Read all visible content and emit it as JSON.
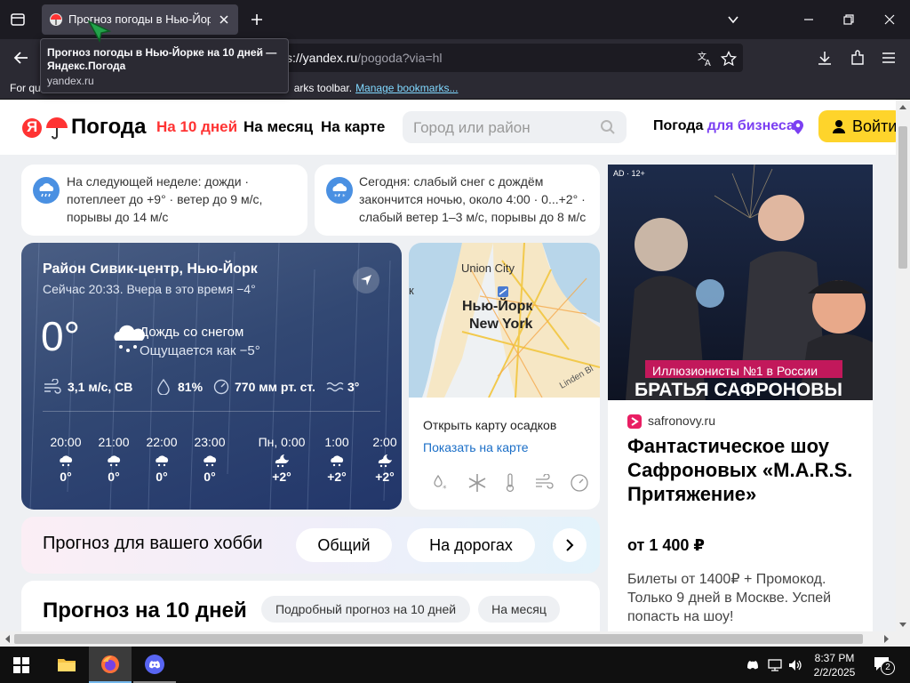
{
  "browser": {
    "tab_title": "Прогноз погоды в Нью-Йорке на 10 дней — Яндекс.Погода",
    "tooltip_title": "Прогноз погоды в Нью-Йорке на 10 дней — Яндекс.Погода",
    "tooltip_domain": "yandex.ru",
    "url_host": "s://yandex.ru",
    "url_path": "/pogoda?via=hl",
    "bookmarks_text_left": "For qu",
    "bookmarks_text_right": "arks toolbar.",
    "bookmarks_link": "Manage bookmarks..."
  },
  "header": {
    "logo_letter": "Я",
    "logo_text": "Погода",
    "nav": [
      "На 10 дней",
      "На месяц",
      "На карте"
    ],
    "search_placeholder": "Город или район",
    "business_prefix": "Погода ",
    "business_accent": "для бизнеса",
    "login_label": "Войти"
  },
  "alerts": [
    "На следующей неделе: дожди · потеплеет до +9° · ветер до 9 м/с, порывы до 14 м/с",
    "Сегодня: слабый снег с дождём закончится ночью, около 4:00 · 0...+2° · слабый ветер 1–3 м/с, порывы до 8 м/с"
  ],
  "weather": {
    "location": "Район Сивик-центр, Нью-Йорк",
    "now_line": "Сейчас 20:33. Вчера в это время −4°",
    "temperature": "0°",
    "condition": "Дождь со снегом",
    "feels_like": "Ощущается как −5°",
    "wind": "3,1 м/с, СВ",
    "humidity": "81%",
    "pressure": "770 мм рт. ст.",
    "water": "3°",
    "hours": [
      {
        "time": "20:00",
        "temp": "0°",
        "icon": "snow"
      },
      {
        "time": "21:00",
        "temp": "0°",
        "icon": "snow"
      },
      {
        "time": "22:00",
        "temp": "0°",
        "icon": "snow"
      },
      {
        "time": "23:00",
        "temp": "0°",
        "icon": "snow"
      },
      {
        "time": "Пн, 0:00",
        "temp": "+2°",
        "icon": "night-snow"
      },
      {
        "time": "1:00",
        "temp": "+2°",
        "icon": "snow"
      },
      {
        "time": "2:00",
        "temp": "+2°",
        "icon": "night-snow"
      }
    ]
  },
  "map": {
    "label_union_city": "Union City",
    "label_city_ru": "Нью-Йорк",
    "label_city_en": "New York",
    "label_k": "к",
    "label_linden": "Linden Bl",
    "title": "Открыть карту осадков",
    "link": "Показать на карте"
  },
  "hobby": {
    "title": "Прогноз для вашего хобби",
    "pills": [
      "Общий",
      "На дорогах"
    ]
  },
  "forecast": {
    "title": "Прогноз на 10 дней",
    "pills": [
      "Подробный прогноз на 10 дней",
      "На месяц"
    ]
  },
  "ad": {
    "badge": "AD · 12+",
    "banner_line1": "Иллюзионисты №1 в России",
    "banner_line2": "БРАТЬЯ САФРОНОВЫ",
    "domain": "safronovy.ru",
    "headline": "Фантастическое шоу Сафроновых «M.A.R.S. Притяжение»",
    "price": "от 1 400 ₽",
    "body": "Билеты от 1400₽ + Промокод. Только 9 дней в Москве. Успей попасть на шоу!"
  },
  "taskbar": {
    "time": "8:37 PM",
    "date": "2/2/2025",
    "notifications": "2"
  },
  "colors": {
    "accent_red": "#f33",
    "business_purple": "#7b3ff2",
    "login_yellow": "#fed42b",
    "link_blue": "#1a6ec7"
  }
}
